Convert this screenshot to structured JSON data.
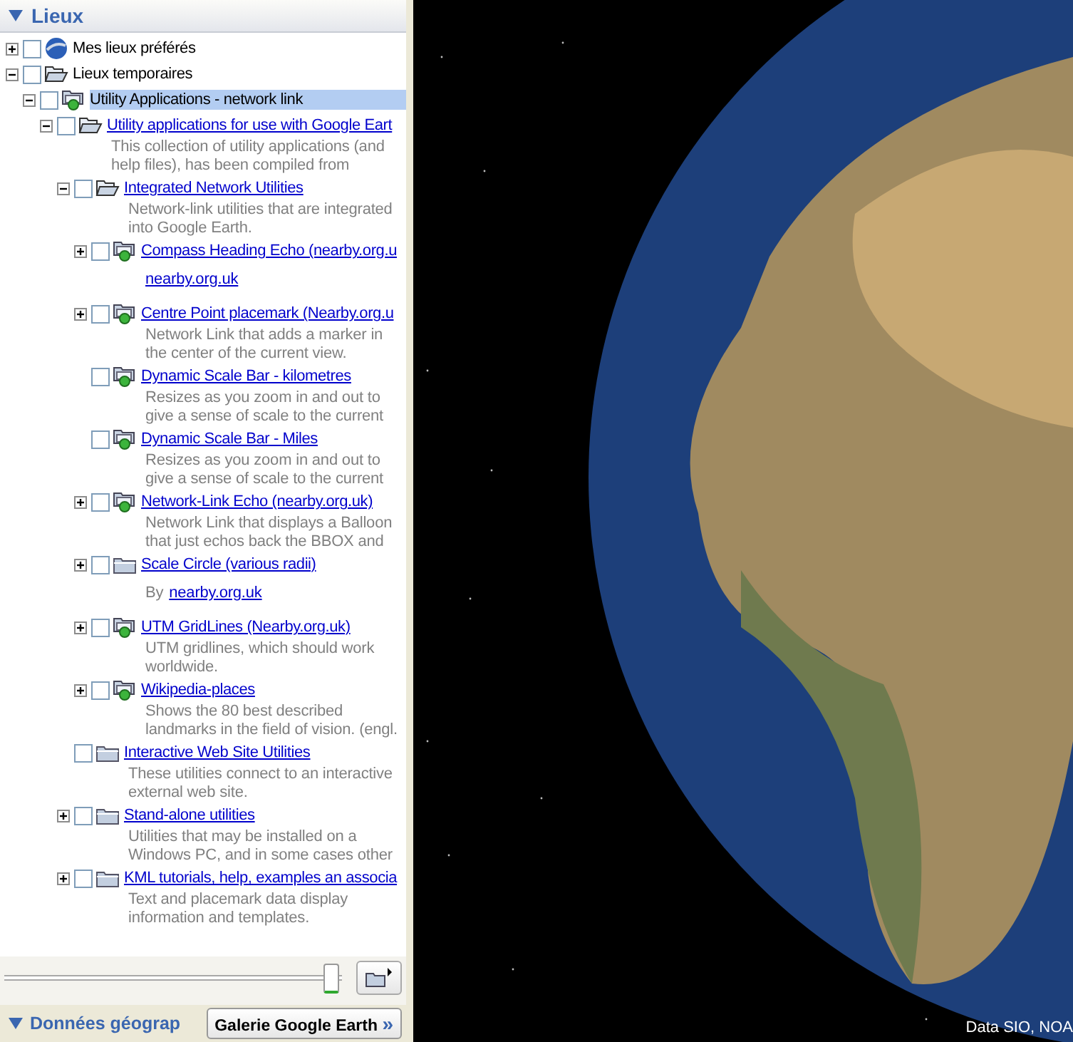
{
  "places_panel": {
    "title": "Lieux",
    "expanded": true,
    "tree": [
      {
        "label": "Mes lieux préférés",
        "kind": "globe",
        "link": false,
        "expandable": true,
        "expanded": false,
        "checked": false,
        "selected": false
      },
      {
        "label": "Lieux temporaires",
        "kind": "folder_open",
        "link": false,
        "expandable": true,
        "expanded": true,
        "checked": false,
        "selected": false,
        "children": [
          {
            "label": "Utility Applications - network link",
            "kind": "network",
            "link": false,
            "expandable": true,
            "expanded": true,
            "checked": false,
            "selected": true,
            "children": [
              {
                "label": "Utility applications for use with Google Eart",
                "kind": "folder_open",
                "link": true,
                "expandable": true,
                "expanded": true,
                "checked": false,
                "selected": false,
                "lines": [
                  "This collection of utility applications (and",
                  "help files), has been compiled from"
                ],
                "children": [
                  {
                    "label": "Integrated Network Utilities",
                    "kind": "folder_open",
                    "link": true,
                    "expandable": true,
                    "expanded": true,
                    "checked": false,
                    "selected": false,
                    "lines": [
                      "Network-link utilities that are integrated",
                      "into Google Earth."
                    ],
                    "children": [
                      {
                        "label": "Compass Heading Echo (nearby.org.u",
                        "kind": "network",
                        "link": true,
                        "expandable": true,
                        "expanded": false,
                        "checked": false,
                        "selected": false,
                        "byline_link": "nearby.org.uk"
                      },
                      {
                        "label": "Centre Point placemark (Nearby.org.u",
                        "kind": "network",
                        "link": true,
                        "expandable": true,
                        "expanded": false,
                        "checked": false,
                        "selected": false,
                        "lines": [
                          "Network Link that adds a marker in",
                          "the center of the current view."
                        ]
                      },
                      {
                        "label": "Dynamic Scale Bar - kilometres",
                        "kind": "network",
                        "link": true,
                        "checked": false,
                        "selected": false,
                        "lines": [
                          "Resizes as you zoom in and out to",
                          "give a sense of scale to the current"
                        ]
                      },
                      {
                        "label": "Dynamic Scale Bar - Miles",
                        "kind": "network",
                        "link": true,
                        "checked": false,
                        "selected": false,
                        "lines": [
                          "Resizes as you zoom in and out to",
                          "give a sense of scale to the current"
                        ]
                      },
                      {
                        "label": "Network-Link Echo (nearby.org.uk)",
                        "kind": "network",
                        "link": true,
                        "expandable": true,
                        "expanded": false,
                        "checked": false,
                        "selected": false,
                        "lines": [
                          "Network Link that displays a Balloon",
                          "that just echos back the BBOX and"
                        ]
                      },
                      {
                        "label": "Scale Circle (various radii)",
                        "kind": "folder",
                        "link": true,
                        "expandable": true,
                        "expanded": false,
                        "checked": false,
                        "selected": false,
                        "byline_prefix": "By",
                        "byline_link": "nearby.org.uk"
                      },
                      {
                        "label": "UTM GridLines (Nearby.org.uk)",
                        "kind": "network",
                        "link": true,
                        "expandable": true,
                        "expanded": false,
                        "checked": false,
                        "selected": false,
                        "lines": [
                          "UTM gridlines, which should work",
                          "worldwide."
                        ]
                      },
                      {
                        "label": "Wikipedia-places",
                        "kind": "network",
                        "link": true,
                        "expandable": true,
                        "expanded": false,
                        "checked": false,
                        "selected": false,
                        "lines": [
                          "Shows the 80 best described",
                          "landmarks in the field of vision. (engl."
                        ]
                      }
                    ]
                  },
                  {
                    "label": "Interactive Web Site Utilities",
                    "kind": "folder",
                    "link": true,
                    "checked": false,
                    "selected": false,
                    "lines": [
                      "These utilities connect to an interactive",
                      "external web site."
                    ]
                  },
                  {
                    "label": "Stand-alone utilities",
                    "kind": "folder",
                    "link": true,
                    "expandable": true,
                    "expanded": false,
                    "checked": false,
                    "selected": false,
                    "lines": [
                      "Utilities that may be installed on a",
                      "Windows PC, and in some cases other"
                    ]
                  },
                  {
                    "label": "KML tutorials, help, examples an associa",
                    "kind": "folder",
                    "link": true,
                    "expandable": true,
                    "expanded": false,
                    "checked": false,
                    "selected": false,
                    "lines": [
                      "Text and placemark data display",
                      "information and templates."
                    ]
                  }
                ]
              }
            ]
          }
        ]
      }
    ]
  },
  "slider": {
    "level": 0.97
  },
  "bottom_bar": {
    "section_title": "Données géograp",
    "section_expanded": true,
    "gallery_button": "Galerie Google Earth",
    "gallery_arrow": "»"
  },
  "map": {
    "attribution": "Data SIO, NOA"
  }
}
